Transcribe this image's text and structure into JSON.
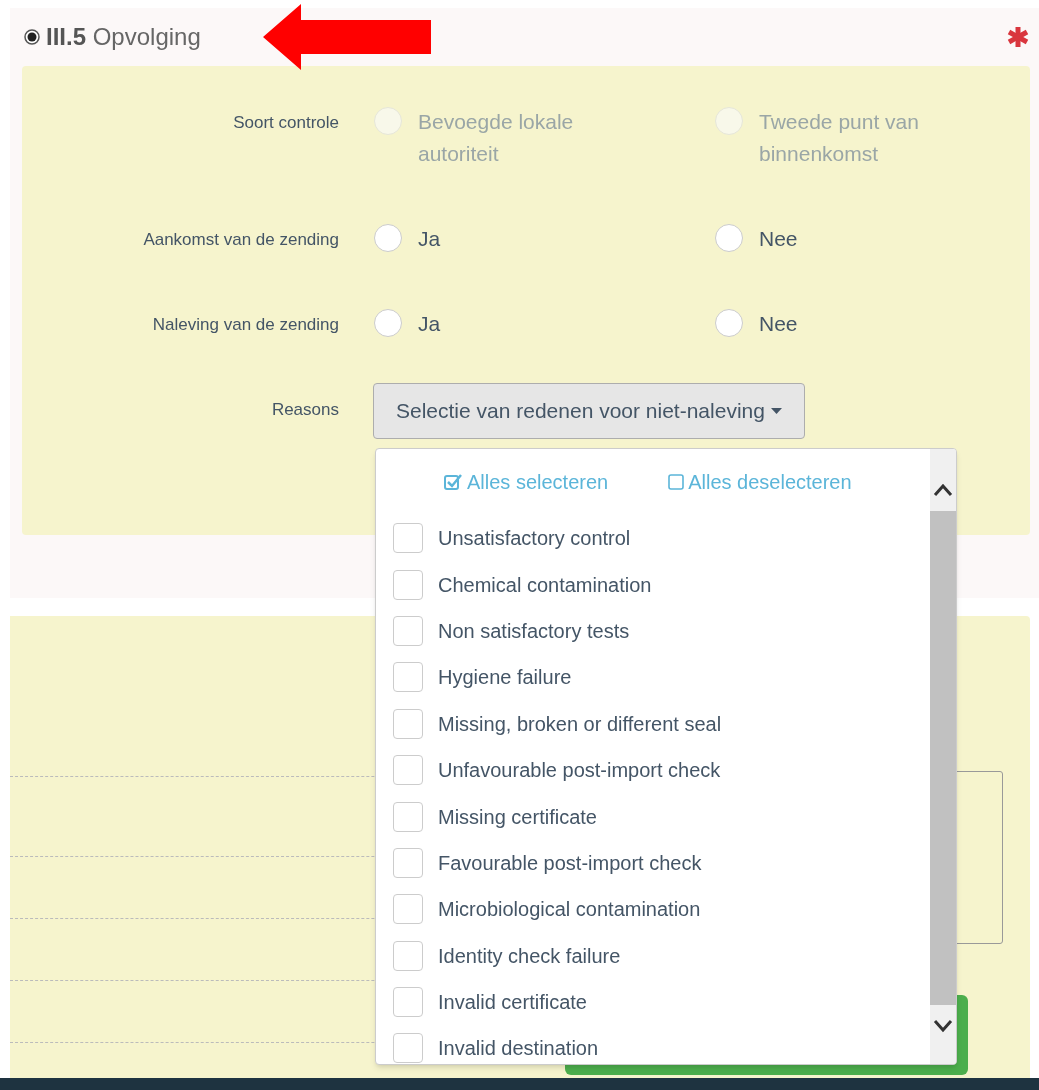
{
  "section": {
    "selected": true,
    "number": "III.5",
    "title": "Opvolging",
    "required": true
  },
  "fields": [
    {
      "kind": "radio",
      "label": "Soort controle",
      "options": [
        {
          "label": "Bevoegde lokale autoriteit",
          "selected": false,
          "disabled": true
        },
        {
          "label": "Tweede punt van binnenkomst",
          "selected": false,
          "disabled": true
        }
      ]
    },
    {
      "kind": "radio",
      "label": "Aankomst van de zending",
      "options": [
        {
          "label": "Ja",
          "selected": false,
          "disabled": false
        },
        {
          "label": "Nee",
          "selected": false,
          "disabled": false
        }
      ]
    },
    {
      "kind": "radio",
      "label": "Naleving van de zending",
      "options": [
        {
          "label": "Ja",
          "selected": false,
          "disabled": false
        },
        {
          "label": "Nee",
          "selected": false,
          "disabled": false
        }
      ]
    },
    {
      "kind": "dropdown",
      "label": "Reasons",
      "button": "Selectie van redenen voor niet-naleving"
    }
  ],
  "dropdown_menu": {
    "select_all": "Alles selecteren",
    "deselect_all": "Alles deselecteren",
    "items": [
      {
        "label": "Unsatisfactory control",
        "checked": false
      },
      {
        "label": "Chemical contamination",
        "checked": false
      },
      {
        "label": "Non satisfactory tests",
        "checked": false
      },
      {
        "label": "Hygiene failure",
        "checked": false
      },
      {
        "label": "Missing, broken or different seal",
        "checked": false
      },
      {
        "label": "Unfavourable post-import check",
        "checked": false
      },
      {
        "label": "Missing certificate",
        "checked": false
      },
      {
        "label": "Favourable post-import check",
        "checked": false
      },
      {
        "label": "Microbiological contamination",
        "checked": false
      },
      {
        "label": "Identity check failure",
        "checked": false
      },
      {
        "label": "Invalid certificate",
        "checked": false
      },
      {
        "label": "Invalid destination",
        "checked": false
      }
    ]
  }
}
